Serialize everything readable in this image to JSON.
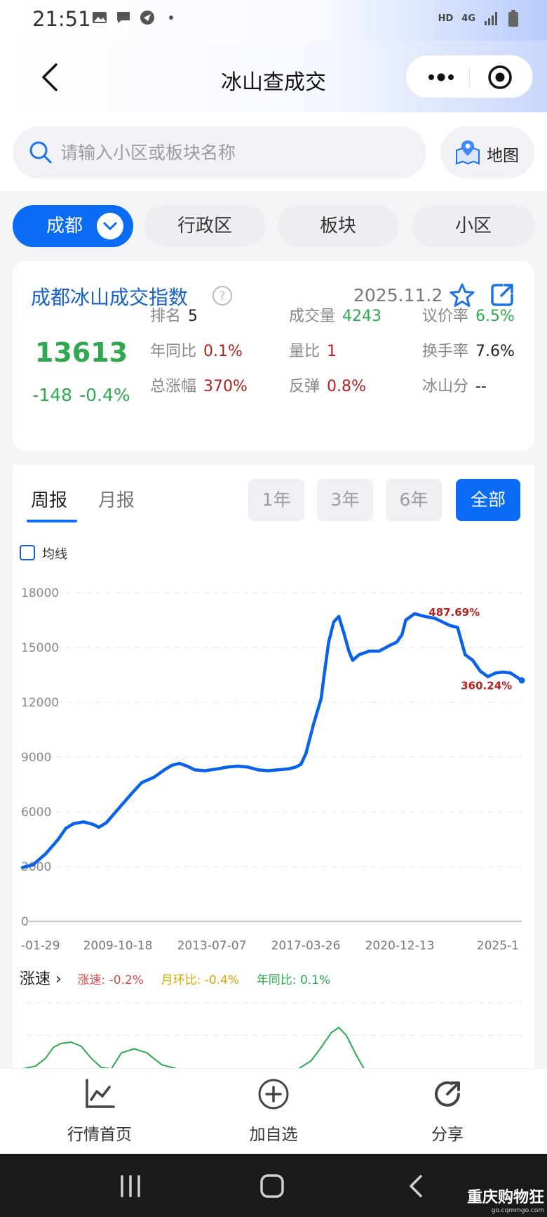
{
  "status_bar": {
    "time": "21:51",
    "hd": "HD",
    "network": "4G"
  },
  "header": {
    "title": "冰山查成交"
  },
  "search": {
    "placeholder": "请输入小区或板块名称",
    "map_label": "地图"
  },
  "filter_tabs": [
    {
      "label": "成都",
      "active": true
    },
    {
      "label": "行政区",
      "active": false
    },
    {
      "label": "板块",
      "active": false
    },
    {
      "label": "小区",
      "active": false
    }
  ],
  "index_card": {
    "title": "成都冰山成交指数",
    "date": "2025.11.2",
    "value": "13613",
    "change": "-148",
    "change_pct": "-0.4%",
    "metrics": [
      {
        "label": "排名",
        "value": "5",
        "color": "#222222"
      },
      {
        "label": "成交量",
        "value": "4243",
        "color": "#2fa84f"
      },
      {
        "label": "议价率",
        "value": "6.5%",
        "color": "#2fa84f"
      },
      {
        "label": "年同比",
        "value": "0.1%",
        "color": "#b51f1f"
      },
      {
        "label": "量比",
        "value": "1",
        "color": "#b51f1f"
      },
      {
        "label": "换手率",
        "value": "7.6%",
        "color": "#222222"
      },
      {
        "label": "总涨幅",
        "value": "370%",
        "color": "#b51f1f"
      },
      {
        "label": "反弹",
        "value": "0.8%",
        "color": "#b51f1f"
      },
      {
        "label": "冰山分",
        "value": "--",
        "color": "#222222"
      }
    ]
  },
  "chart_controls": {
    "period_tabs": [
      {
        "label": "周报",
        "active": true
      },
      {
        "label": "月报",
        "active": false
      }
    ],
    "ranges": [
      {
        "label": "1年",
        "active": false
      },
      {
        "label": "3年",
        "active": false
      },
      {
        "label": "6年",
        "active": false
      },
      {
        "label": "全部",
        "active": true
      }
    ],
    "ma_label": "均线"
  },
  "speed_section": {
    "label": "涨速",
    "items": [
      {
        "text": "涨速: -0.2%",
        "color": "#d94a4a"
      },
      {
        "text": "月环比: -0.4%",
        "color": "#e0a400"
      },
      {
        "text": "年同比: 0.1%",
        "color": "#2fa84f"
      }
    ]
  },
  "chart_data": [
    {
      "type": "line",
      "ylim": [
        0,
        18000
      ],
      "yticks": [
        "18000",
        "15000",
        "12000",
        "9000",
        "6000",
        "3000",
        "0"
      ],
      "xticks": [
        "-01-29",
        "2009-10-18",
        "2013-07-07",
        "2017-03-26",
        "2020-12-13",
        "2025-1"
      ],
      "xrange": [
        2006.08,
        2025.84
      ],
      "annotations": [
        {
          "text": "487.69%",
          "x": 2021.6,
          "y": 16800
        },
        {
          "text": "360.24%",
          "x": 2024.5,
          "y": 13400
        }
      ],
      "line_color": "#0a62e8",
      "series": [
        {
          "points": [
            [
              2006.08,
              2950
            ],
            [
              2006.5,
              3100
            ],
            [
              2007.0,
              3700
            ],
            [
              2007.5,
              4500
            ],
            [
              2007.8,
              5100
            ],
            [
              2008.1,
              5350
            ],
            [
              2008.5,
              5450
            ],
            [
              2008.9,
              5300
            ],
            [
              2009.1,
              5150
            ],
            [
              2009.4,
              5400
            ],
            [
              2009.9,
              6200
            ],
            [
              2010.4,
              7000
            ],
            [
              2010.8,
              7600
            ],
            [
              2011.3,
              7900
            ],
            [
              2011.7,
              8300
            ],
            [
              2012.0,
              8550
            ],
            [
              2012.3,
              8650
            ],
            [
              2012.6,
              8500
            ],
            [
              2012.9,
              8300
            ],
            [
              2013.3,
              8250
            ],
            [
              2013.8,
              8350
            ],
            [
              2014.2,
              8450
            ],
            [
              2014.6,
              8500
            ],
            [
              2015.0,
              8450
            ],
            [
              2015.4,
              8300
            ],
            [
              2015.8,
              8250
            ],
            [
              2016.2,
              8300
            ],
            [
              2016.6,
              8350
            ],
            [
              2016.9,
              8450
            ],
            [
              2017.1,
              8600
            ],
            [
              2017.3,
              9200
            ],
            [
              2017.6,
              10800
            ],
            [
              2017.9,
              12200
            ],
            [
              2018.05,
              13800
            ],
            [
              2018.2,
              15300
            ],
            [
              2018.4,
              16400
            ],
            [
              2018.6,
              16700
            ],
            [
              2018.8,
              15800
            ],
            [
              2019.0,
              14800
            ],
            [
              2019.15,
              14300
            ],
            [
              2019.4,
              14600
            ],
            [
              2019.8,
              14800
            ],
            [
              2020.2,
              14800
            ],
            [
              2020.6,
              15100
            ],
            [
              2020.9,
              15300
            ],
            [
              2021.1,
              15700
            ],
            [
              2021.25,
              16500
            ],
            [
              2021.6,
              16850
            ],
            [
              2022.0,
              16700
            ],
            [
              2022.4,
              16600
            ],
            [
              2022.7,
              16400
            ],
            [
              2023.0,
              16200
            ],
            [
              2023.3,
              16100
            ],
            [
              2023.6,
              14600
            ],
            [
              2023.9,
              14300
            ],
            [
              2024.2,
              13700
            ],
            [
              2024.5,
              13400
            ],
            [
              2024.8,
              13600
            ],
            [
              2025.1,
              13650
            ],
            [
              2025.4,
              13600
            ],
            [
              2025.84,
              13200
            ]
          ]
        }
      ]
    },
    {
      "type": "line",
      "series": [
        {
          "name": "年同比",
          "color": "#2fa84f",
          "points": [
            [
              2006.08,
              0
            ],
            [
              2006.6,
              0.1
            ],
            [
              2007.0,
              0.4
            ],
            [
              2007.3,
              0.8
            ],
            [
              2007.6,
              0.95
            ],
            [
              2008.0,
              1.0
            ],
            [
              2008.4,
              0.85
            ],
            [
              2008.8,
              0.4
            ],
            [
              2009.2,
              0.05
            ],
            [
              2009.6,
              0.0
            ],
            [
              2010.0,
              0.6
            ],
            [
              2010.5,
              0.75
            ],
            [
              2011.0,
              0.6
            ],
            [
              2011.6,
              0.15
            ],
            [
              2012.2,
              0.0
            ],
            [
              2014.0,
              0.0
            ],
            [
              2016.0,
              0.0
            ],
            [
              2017.0,
              0.0
            ],
            [
              2017.5,
              0.3
            ],
            [
              2017.9,
              0.8
            ],
            [
              2018.3,
              1.35
            ],
            [
              2018.6,
              1.55
            ],
            [
              2018.9,
              1.25
            ],
            [
              2019.3,
              0.5
            ],
            [
              2019.6,
              0.0
            ],
            [
              2021.0,
              0.0
            ],
            [
              2023.0,
              0.0
            ],
            [
              2025.84,
              0.0
            ]
          ]
        }
      ]
    }
  ],
  "bottom_nav": [
    {
      "label": "行情首页"
    },
    {
      "label": "加自选"
    },
    {
      "label": "分享"
    }
  ],
  "watermark": {
    "line1": "重庆购物狂",
    "line2": "go.cqmmgo.com"
  }
}
